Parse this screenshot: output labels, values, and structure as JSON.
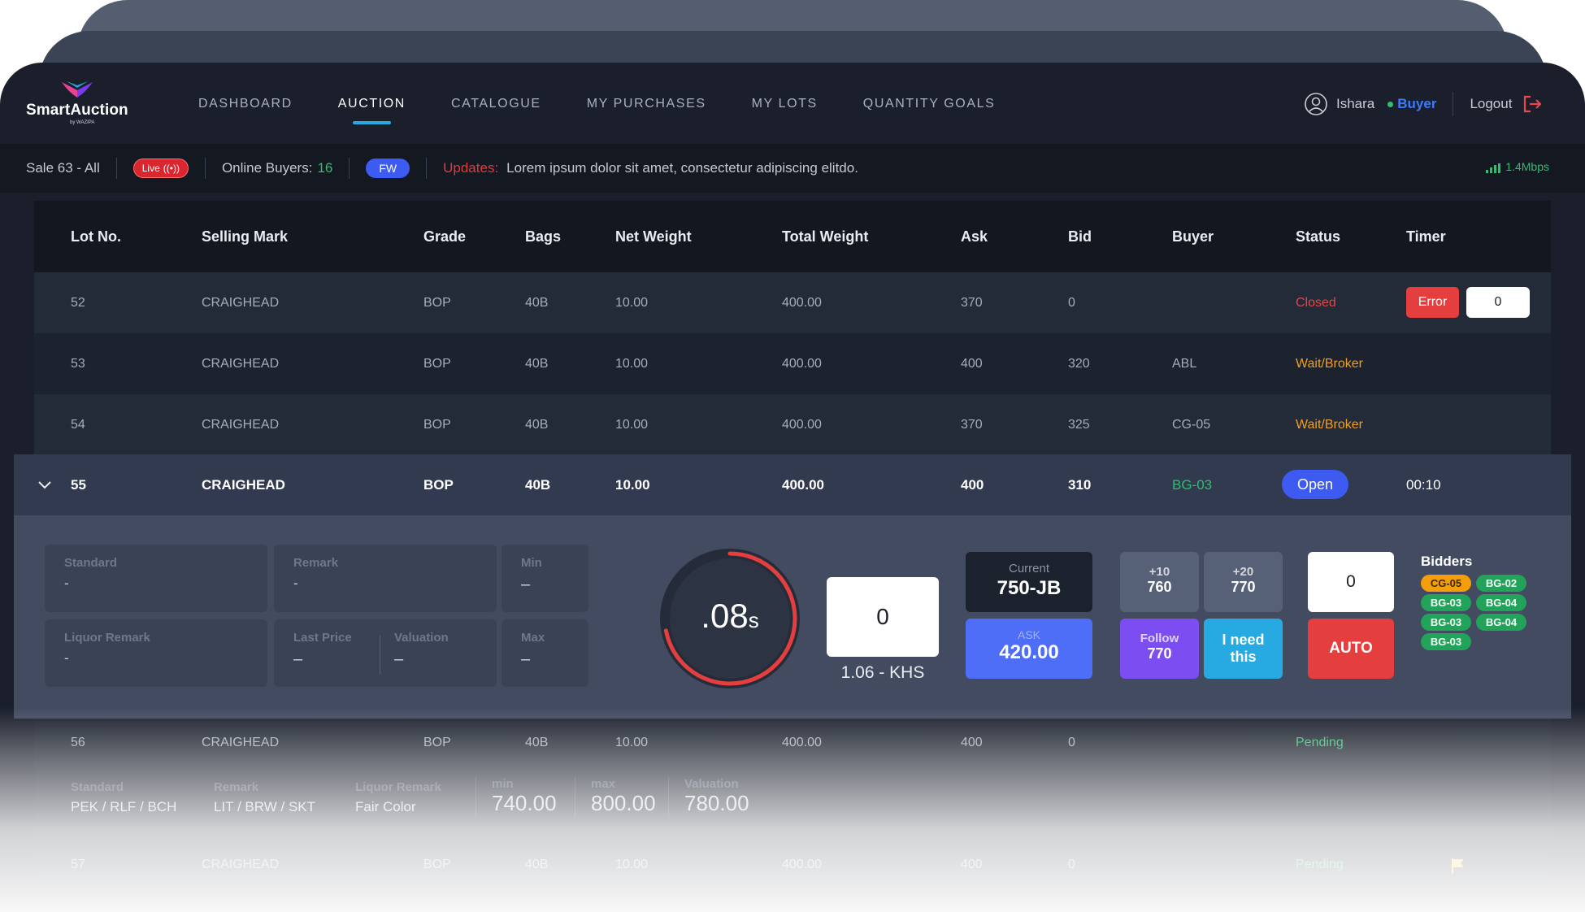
{
  "brand": {
    "name": "SmartAuction",
    "sub": "by WAZIPA"
  },
  "nav": {
    "items": [
      "DASHBOARD",
      "AUCTION",
      "CATALOGUE",
      "MY PURCHASES",
      "MY LOTS",
      "QUANTITY GOALS"
    ],
    "active": "AUCTION"
  },
  "user": {
    "name": "Ishara",
    "role": "Buyer",
    "logout_label": "Logout"
  },
  "status_bar": {
    "sale": "Sale 63 - All",
    "live_label": "Live",
    "online_label": "Online Buyers:",
    "online_count": "16",
    "fw_label": "FW",
    "updates_label": "Updates:",
    "updates_text": "Lorem ipsum dolor sit amet, consectetur adipiscing elitdo.",
    "speed": "1.4Mbps"
  },
  "table": {
    "headers": [
      "Lot No.",
      "Selling Mark",
      "Grade",
      "Bags",
      "Net Weight",
      "Total Weight",
      "Ask",
      "Bid",
      "Buyer",
      "Status",
      "Timer"
    ],
    "rows": [
      {
        "lot": "52",
        "mark": "CRAIGHEAD",
        "grade": "BOP",
        "bags": "40B",
        "net": "10.00",
        "total": "400.00",
        "ask": "370",
        "bid": "0",
        "buyer": "",
        "status": "Closed",
        "error_label": "Error",
        "timer_value": "0"
      },
      {
        "lot": "53",
        "mark": "CRAIGHEAD",
        "grade": "BOP",
        "bags": "40B",
        "net": "10.00",
        "total": "400.00",
        "ask": "400",
        "bid": "320",
        "buyer": "ABL",
        "status": "Wait/Broker"
      },
      {
        "lot": "54",
        "mark": "CRAIGHEAD",
        "grade": "BOP",
        "bags": "40B",
        "net": "10.00",
        "total": "400.00",
        "ask": "370",
        "bid": "325",
        "buyer": "CG-05",
        "status": "Wait/Broker"
      }
    ],
    "expanded": {
      "lot": "55",
      "mark": "CRAIGHEAD",
      "grade": "BOP",
      "bags": "40B",
      "net": "10.00",
      "total": "400.00",
      "ask": "400",
      "bid": "310",
      "buyer": "BG-03",
      "status": "Open",
      "timer": "00:10"
    },
    "after": [
      {
        "lot": "56",
        "mark": "CRAIGHEAD",
        "grade": "BOP",
        "bags": "40B",
        "net": "10.00",
        "total": "400.00",
        "ask": "400",
        "bid": "0",
        "status": "Pending"
      },
      {
        "lot": "57",
        "mark": "CRAIGHEAD",
        "grade": "BOP",
        "bags": "40B",
        "net": "10.00",
        "total": "400.00",
        "ask": "400",
        "bid": "0",
        "status": "Pending"
      }
    ]
  },
  "panel": {
    "standard_label": "Standard",
    "standard_value": "-",
    "remark_label": "Remark",
    "remark_value": "-",
    "min_label": "Min",
    "min_value": "–",
    "liquor_label": "Liquor Remark",
    "liquor_value": "-",
    "last_price_label": "Last Price",
    "last_price_value": "–",
    "valuation_label": "Valuation",
    "valuation_value": "–",
    "max_label": "Max",
    "max_value": "–",
    "countdown": ".08",
    "countdown_unit": "s",
    "countdown_progress": 0.72,
    "bid_box": "0",
    "khs": "1.06 - KHS",
    "current_label": "Current",
    "current_value": "750-JB",
    "ask_label": "ASK",
    "ask_value": "420.00",
    "plus10_label": "+10",
    "plus10_value": "760",
    "plus20_label": "+20",
    "plus20_value": "770",
    "follow_label": "Follow",
    "follow_value": "770",
    "ineed_line1": "I need",
    "ineed_line2": "this",
    "auto_value": "0",
    "auto_label": "AUTO",
    "bidders_title": "Bidders",
    "bidders": [
      {
        "name": "CG-05",
        "color": "#f59e0b"
      },
      {
        "name": "BG-02",
        "color": "#22a35a"
      },
      {
        "name": "BG-03",
        "color": "#22a35a"
      },
      {
        "name": "BG-04",
        "color": "#22a35a"
      },
      {
        "name": "BG-03",
        "color": "#22a35a"
      },
      {
        "name": "BG-04",
        "color": "#22a35a"
      },
      {
        "name": "BG-03",
        "color": "#22a35a"
      }
    ]
  },
  "lot56_details": {
    "standard_label": "Standard",
    "standard_value": "PEK / RLF / BCH",
    "remark_label": "Remark",
    "remark_value": "LIT  /  BRW  / SKT",
    "liquor_label": "Liquor Remark",
    "liquor_value": "Fair Color",
    "min_label": "min",
    "min_value": "740.00",
    "max_label": "max",
    "max_value": "800.00",
    "valuation_label": "Valuation",
    "valuation_value": "780.00"
  },
  "colors": {
    "accent": "#3d5af1",
    "danger": "#e53e3e",
    "success": "#2fbf71",
    "warning": "#f0a020",
    "tab_underline": "#27a9e1"
  }
}
